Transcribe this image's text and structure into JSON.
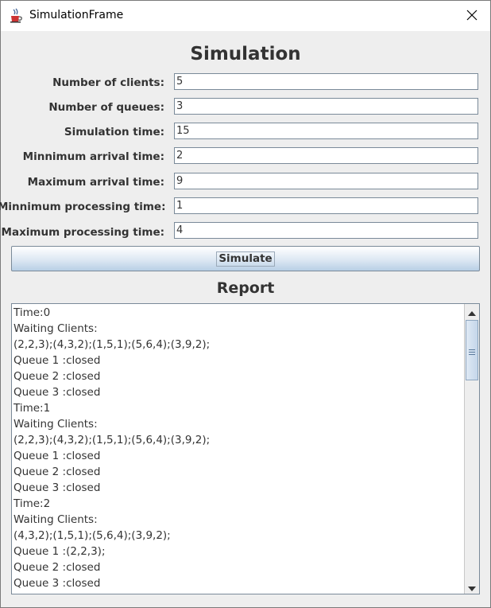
{
  "window": {
    "title": "SimulationFrame",
    "icon": "java-cup-icon",
    "close_glyph": "✕"
  },
  "main": {
    "heading": "Simulation",
    "fields": [
      {
        "label": "Number of clients:",
        "value": "5"
      },
      {
        "label": "Number of queues:",
        "value": "3"
      },
      {
        "label": "Simulation time:",
        "value": "15"
      },
      {
        "label": "Minnimum arrival time:",
        "value": "2"
      },
      {
        "label": "Maximum arrival time:",
        "value": "9"
      },
      {
        "label": "Minnimum processing time:",
        "value": "1"
      },
      {
        "label": "Maximum processing time:",
        "value": "4"
      }
    ],
    "simulate_label": "Simulate",
    "report_heading": "Report"
  },
  "report": {
    "lines": [
      "Time:0",
      "Waiting Clients:",
      "(2,2,3);(4,3,2);(1,5,1);(5,6,4);(3,9,2);",
      "Queue 1 :closed",
      "Queue 2 :closed",
      "Queue 3 :closed",
      "Time:1",
      "Waiting Clients:",
      "(2,2,3);(4,3,2);(1,5,1);(5,6,4);(3,9,2);",
      "Queue 1 :closed",
      "Queue 2 :closed",
      "Queue 3 :closed",
      "Time:2",
      "Waiting Clients:",
      "(4,3,2);(1,5,1);(5,6,4);(3,9,2);",
      "Queue 1 :(2,2,3);",
      "Queue 2 :closed",
      "Queue 3 :closed"
    ]
  },
  "scrollbar": {
    "up_icon": "arrow-up-icon",
    "down_icon": "arrow-down-icon",
    "scroll_position": 0.0
  },
  "colors": {
    "panel": "#eeeeee",
    "button_gradient_bottom": "#b8cfe5",
    "text": "#333333"
  }
}
